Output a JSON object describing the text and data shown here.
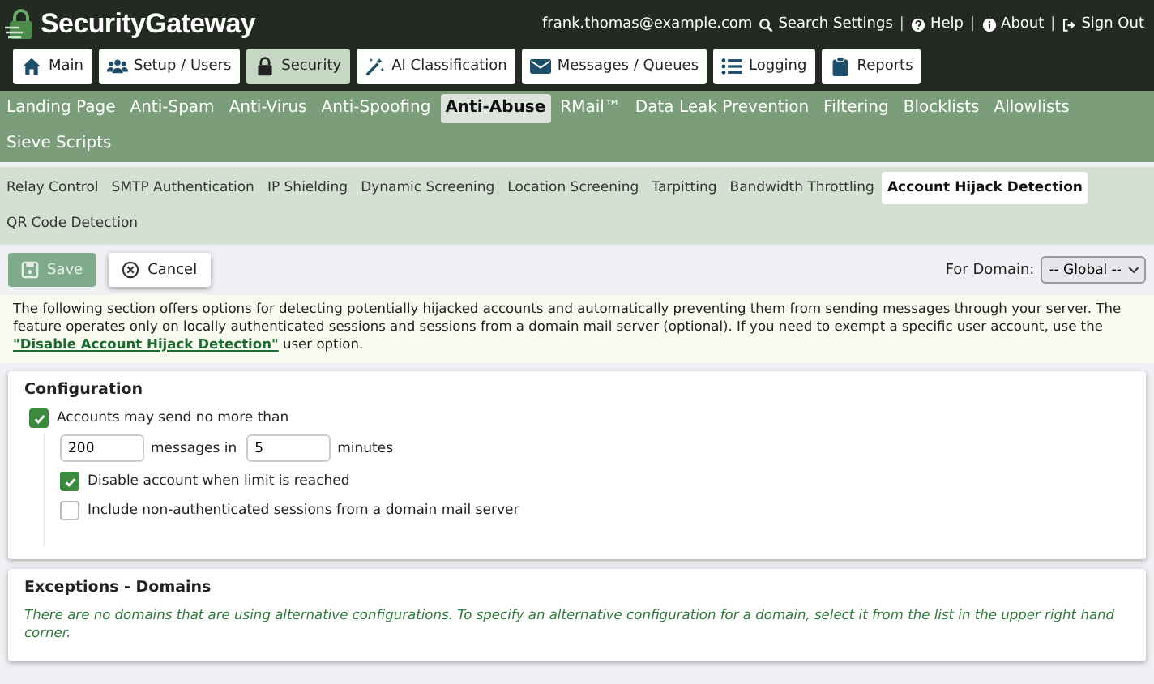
{
  "header": {
    "logo": "SecurityGateway",
    "user": "frank.thomas@example.com",
    "links": [
      {
        "label": "Search Settings"
      },
      {
        "label": "Help",
        "separator": "|"
      },
      {
        "label": "About",
        "separator": "|"
      },
      {
        "label": "Sign Out",
        "separator": "|"
      }
    ]
  },
  "main_tabs": [
    {
      "label": "Main",
      "selected": false
    },
    {
      "label": "Setup / Users",
      "selected": false
    },
    {
      "label": "Security",
      "selected": true
    },
    {
      "label": "AI Classification",
      "selected": false
    },
    {
      "label": "Messages / Queues",
      "selected": false
    },
    {
      "label": "Logging",
      "selected": false
    },
    {
      "label": "Reports",
      "selected": false
    }
  ],
  "sub_tabs": [
    {
      "label": "Landing Page",
      "selected": false
    },
    {
      "label": "Anti-Spam",
      "selected": false
    },
    {
      "label": "Anti-Virus",
      "selected": false
    },
    {
      "label": "Anti-Spoofing",
      "selected": false
    },
    {
      "label": "Anti-Abuse",
      "selected": true
    },
    {
      "label": "RMail™",
      "selected": false
    },
    {
      "label": "Data Leak Prevention",
      "selected": false
    },
    {
      "label": "Filtering",
      "selected": false
    },
    {
      "label": "Blocklists",
      "selected": false
    },
    {
      "label": "Allowlists",
      "selected": false
    },
    {
      "label": "Sieve Scripts",
      "selected": false
    }
  ],
  "section_tabs": [
    {
      "label": "Relay Control",
      "selected": false
    },
    {
      "label": "SMTP Authentication",
      "selected": false
    },
    {
      "label": "IP Shielding",
      "selected": false
    },
    {
      "label": "Dynamic Screening",
      "selected": false
    },
    {
      "label": "Location Screening",
      "selected": false
    },
    {
      "label": "Tarpitting",
      "selected": false
    },
    {
      "label": "Bandwidth Throttling",
      "selected": false
    },
    {
      "label": "Account Hijack Detection",
      "selected": true
    },
    {
      "label": "QR Code Detection",
      "selected": false
    }
  ],
  "toolbar": {
    "save": {
      "label": "Save",
      "disabled": true
    },
    "cancel": {
      "label": "Cancel"
    },
    "domain_label": "For Domain:",
    "domain_value": "-- Global --"
  },
  "description": {
    "text": "The following section offers options for detecting potentially hijacked accounts and automatically preventing them from sending messages through your server. The feature operates only on locally authenticated sessions and sessions from a domain mail server (optional). If you need to exempt a specific user account, use the",
    "link": "\"Disable Account Hijack Detection\"",
    "after": "user option."
  },
  "configuration": {
    "title": "Configuration",
    "limit": {
      "label": "Accounts may send no more than",
      "checked": true
    },
    "messages": "200",
    "messages_label": "messages in",
    "minutes": "5",
    "minutes_label": "minutes",
    "options": [
      {
        "label": "Disable account when limit is reached",
        "checked": true
      },
      {
        "label": "Include non-authenticated sessions from a domain mail server",
        "checked": false
      }
    ]
  },
  "exceptions": {
    "title": "Exceptions - Domains",
    "message": "There are no domains that are using alternative configurations. To specify an alternative configuration for a domain, select it from the list in the upper right hand corner."
  }
}
